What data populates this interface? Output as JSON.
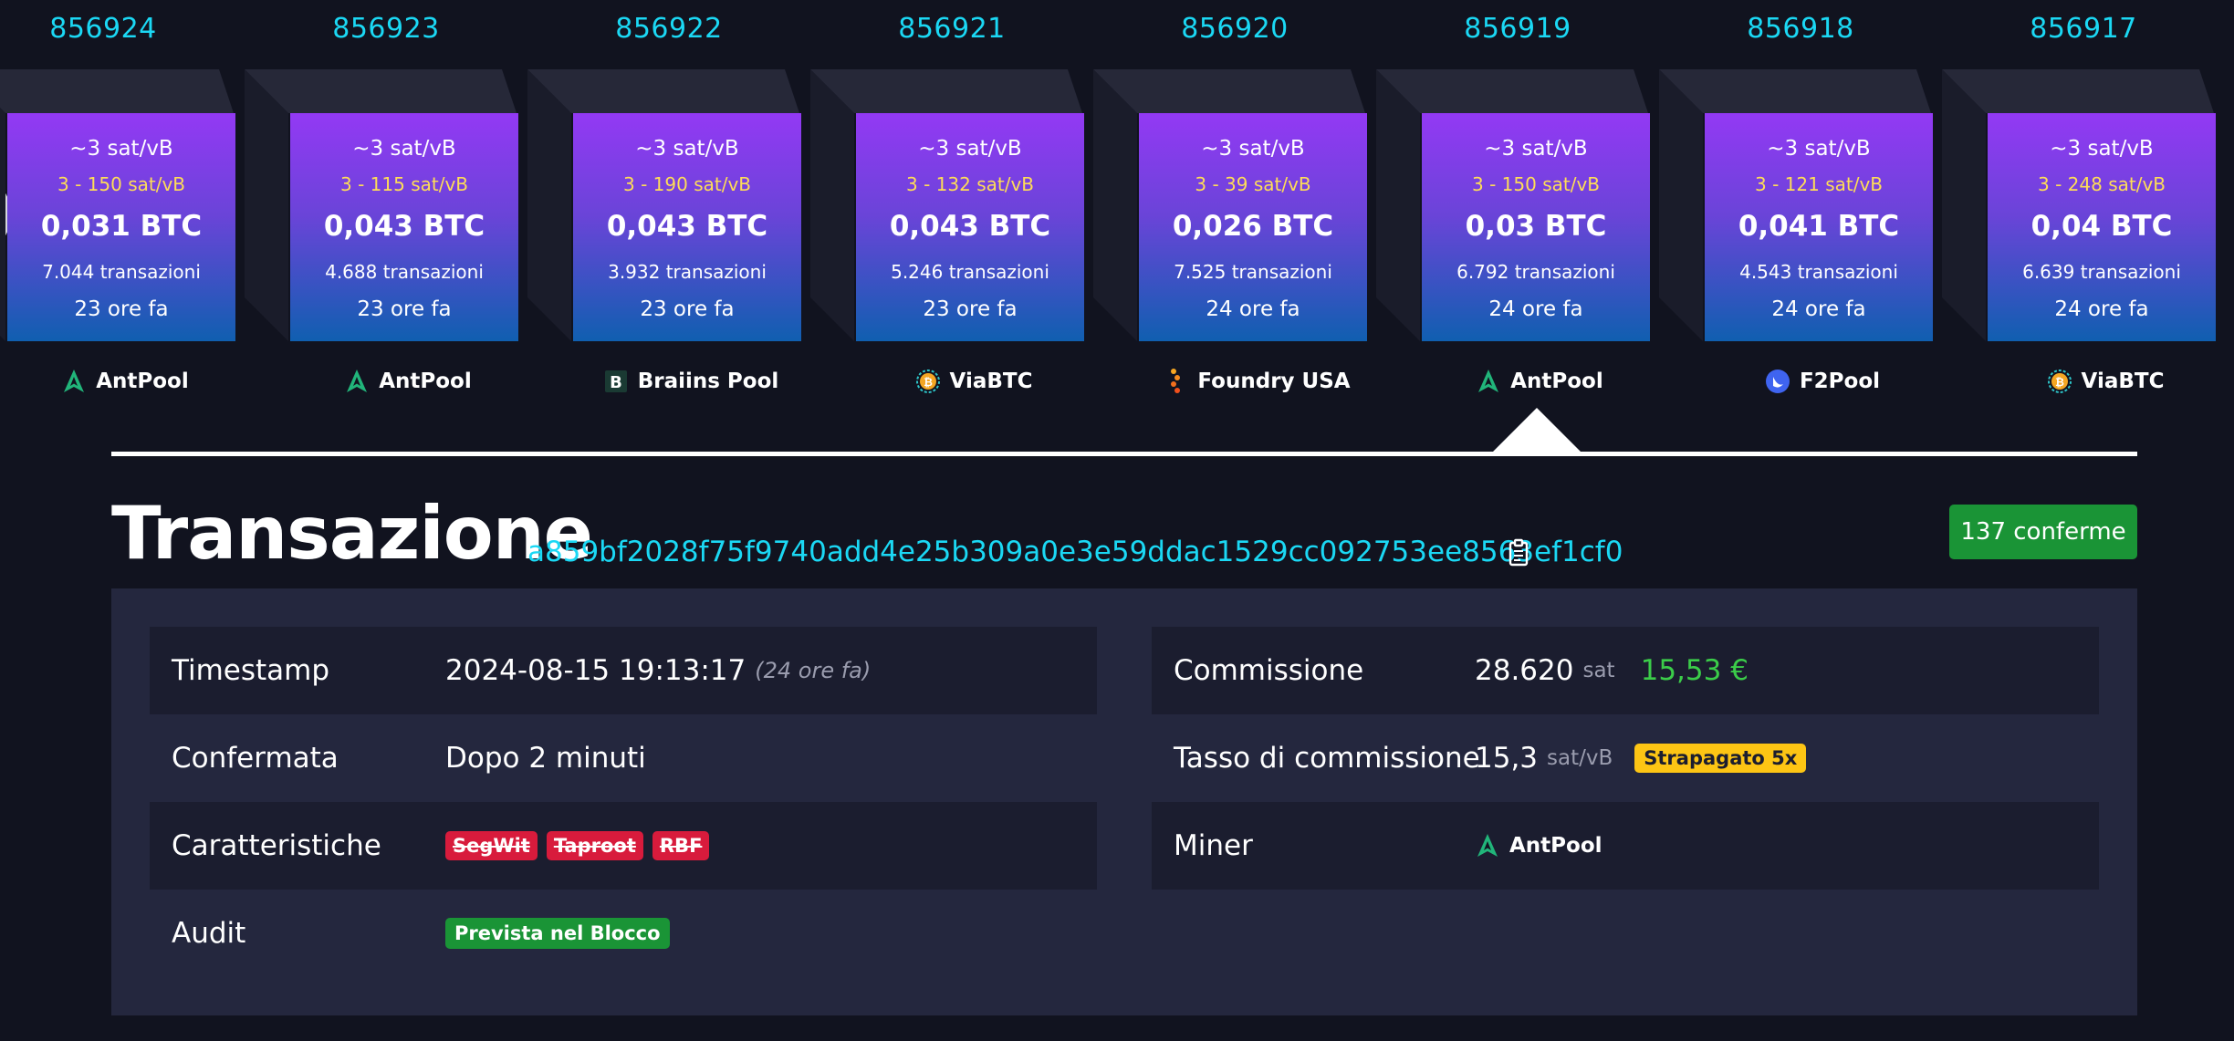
{
  "blocks": [
    {
      "height": "856924",
      "fee_median": "~3 sat/vB",
      "fee_span": "3 - 150 sat/vB",
      "size": "0,031 BTC",
      "tx_count": "7.044 transazioni",
      "time_ago": "23 ore fa",
      "pool": "AntPool",
      "pool_icon": "antpool-icon"
    },
    {
      "height": "856923",
      "fee_median": "~3 sat/vB",
      "fee_span": "3 - 115 sat/vB",
      "size": "0,043 BTC",
      "tx_count": "4.688 transazioni",
      "time_ago": "23 ore fa",
      "pool": "AntPool",
      "pool_icon": "antpool-icon"
    },
    {
      "height": "856922",
      "fee_median": "~3 sat/vB",
      "fee_span": "3 - 190 sat/vB",
      "size": "0,043 BTC",
      "tx_count": "3.932 transazioni",
      "time_ago": "23 ore fa",
      "pool": "Braiins Pool",
      "pool_icon": "braiins-icon"
    },
    {
      "height": "856921",
      "fee_median": "~3 sat/vB",
      "fee_span": "3 - 132 sat/vB",
      "size": "0,043 BTC",
      "tx_count": "5.246 transazioni",
      "time_ago": "23 ore fa",
      "pool": "ViaBTC",
      "pool_icon": "viabtc-icon"
    },
    {
      "height": "856920",
      "fee_median": "~3 sat/vB",
      "fee_span": "3 - 39 sat/vB",
      "size": "0,026 BTC",
      "tx_count": "7.525 transazioni",
      "time_ago": "24 ore fa",
      "pool": "Foundry USA",
      "pool_icon": "foundry-icon"
    },
    {
      "height": "856919",
      "fee_median": "~3 sat/vB",
      "fee_span": "3 - 150 sat/vB",
      "size": "0,03 BTC",
      "tx_count": "6.792 transazioni",
      "time_ago": "24 ore fa",
      "pool": "AntPool",
      "pool_icon": "antpool-icon"
    },
    {
      "height": "856918",
      "fee_median": "~3 sat/vB",
      "fee_span": "3 - 121 sat/vB",
      "size": "0,041 BTC",
      "tx_count": "4.543 transazioni",
      "time_ago": "24 ore fa",
      "pool": "F2Pool",
      "pool_icon": "f2pool-icon"
    },
    {
      "height": "856917",
      "fee_median": "~3 sat/vB",
      "fee_span": "3 - 248 sat/vB",
      "size": "0,04 BTC",
      "tx_count": "6.639 transazioni",
      "time_ago": "24 ore fa",
      "pool": "ViaBTC",
      "pool_icon": "viabtc-icon"
    }
  ],
  "transaction": {
    "title": "Transazione",
    "txid": "a859bf2028f75f9740add4e25b309a0e3e59ddac1529cc092753ee8563ef1cf0",
    "confirmations": "137 conferme"
  },
  "details": {
    "left": {
      "timestamp_label": "Timestamp",
      "timestamp_value": "2024-08-15 19:13:17",
      "timestamp_relative": "(24 ore fa)",
      "confirmed_label": "Confermata",
      "confirmed_value": "Dopo 2 minuti",
      "features_label": "Caratteristiche",
      "features": [
        "SegWit",
        "Taproot",
        "RBF"
      ],
      "audit_label": "Audit",
      "audit_value": "Prevista nel Blocco"
    },
    "right": {
      "fee_label": "Commissione",
      "fee_value": "28.620",
      "fee_unit": "sat",
      "fee_fiat": "15,53 €",
      "fee_rate_label": "Tasso di commissione",
      "fee_rate_value": "15,3",
      "fee_rate_unit": "sat/vB",
      "fee_rate_badge": "Strapagato 5x",
      "miner_label": "Miner",
      "miner_value": "AntPool"
    }
  },
  "colors": {
    "background": "#11131f",
    "accent_link": "#1bd8f4",
    "fee_span": "#fedd57",
    "fiat_green": "#3bcc49",
    "badge_green": "#1a9436",
    "badge_red": "#d81b3c",
    "badge_yellow": "#fdc514",
    "block_gradient_top": "#9339f4",
    "block_gradient_bottom": "#105fb0"
  }
}
